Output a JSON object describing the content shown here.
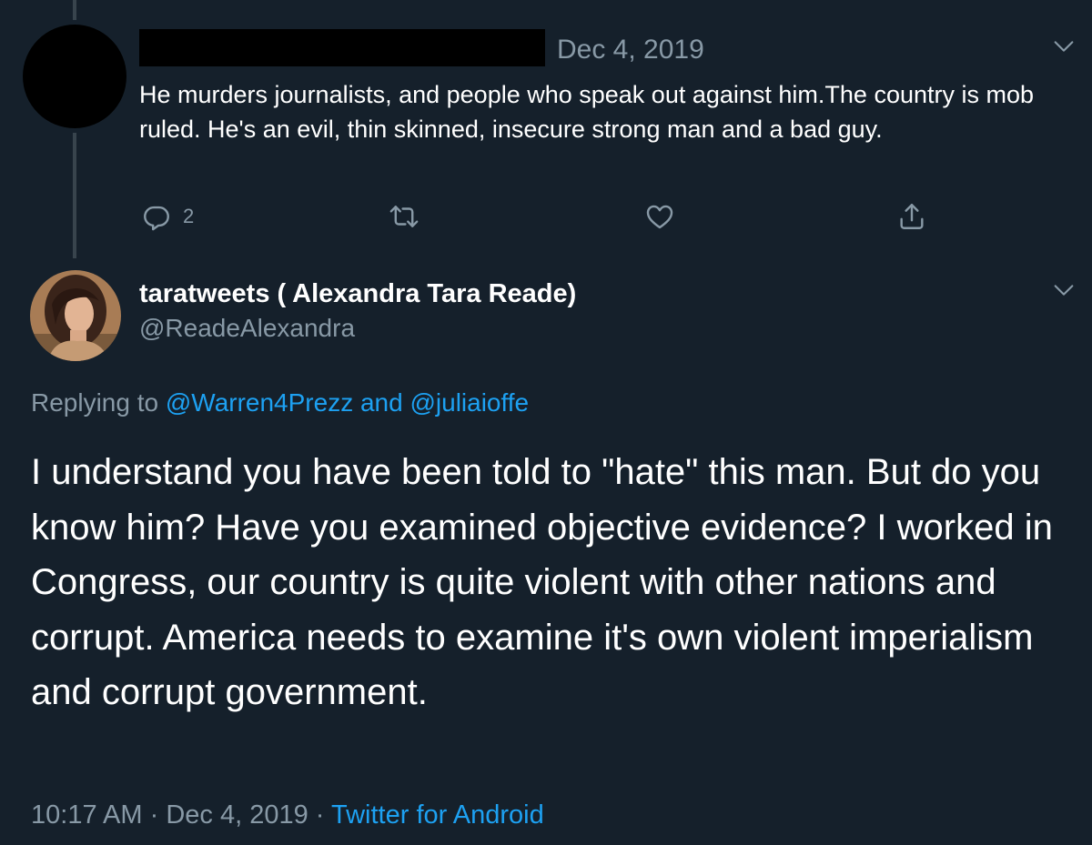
{
  "parent_tweet": {
    "date": "Dec 4, 2019",
    "text": "He murders journalists, and people who speak out against him.The country is mob ruled.  He's an evil, thin skinned,  insecure strong man and a bad guy.",
    "reply_count": "2"
  },
  "main_tweet": {
    "display_name": "taratweets ( Alexandra Tara Reade)",
    "handle": "@ReadeAlexandra",
    "replying_prefix": "Replying to",
    "replying_user_1": "@Warren4Prezz",
    "replying_joiner": "and",
    "replying_user_2": "@juliaioffe",
    "text": "I understand you have been told to \"hate\" this man. But do you know him? Have you examined objective evidence?  I worked in Congress, our country is quite violent with other nations and corrupt.  America needs to examine it's own violent imperialism and corrupt government.",
    "time": "10:17 AM",
    "date": "Dec 4, 2019",
    "separator": "·",
    "source": "Twitter for Android"
  },
  "icons": {
    "reply": "reply-icon",
    "retweet": "retweet-icon",
    "like": "heart-icon",
    "share": "share-icon",
    "more": "chevron-down-icon"
  },
  "colors": {
    "background": "#15202b",
    "text": "#ffffff",
    "secondary": "#8899a6",
    "link": "#1da1f2",
    "thread_line": "#38444d"
  }
}
